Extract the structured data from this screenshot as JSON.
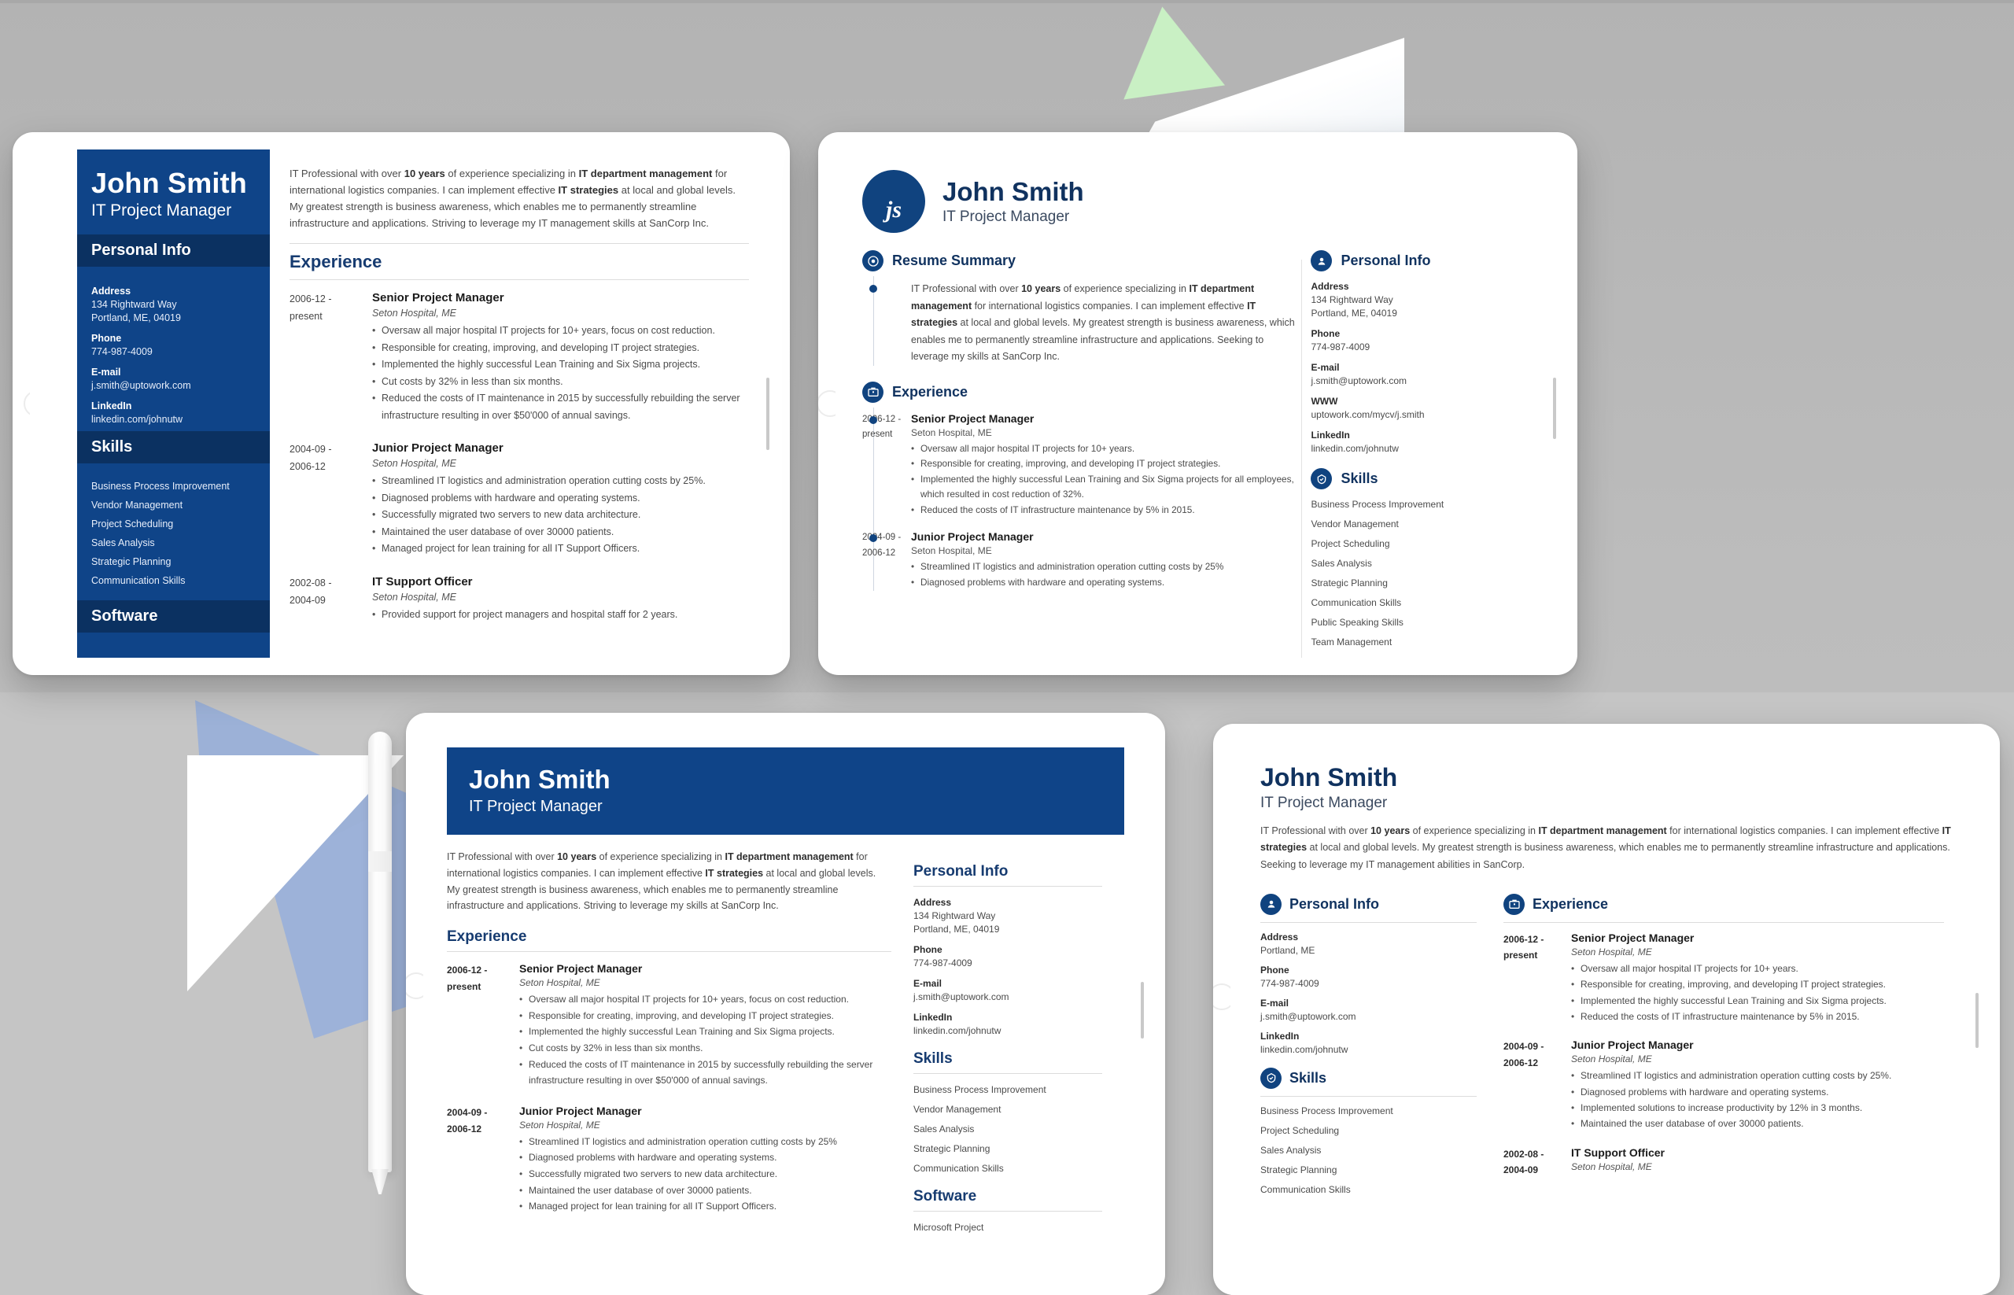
{
  "person": {
    "name": "John Smith",
    "title": "IT Project Manager",
    "initials": "js"
  },
  "colors": {
    "brand_navy": "#0f4488",
    "brand_dark_navy": "#0b3161",
    "heading_navy": "#163b70",
    "background_gray": "#b9b9b9",
    "accent_green": "#c9f0c4",
    "accent_blue": "#9ab0d8"
  },
  "summaries": {
    "long_sancorp_skills": {
      "p1": "IT Professional with over ",
      "b1": "10 years",
      "p2": " of experience specializing in ",
      "b2": "IT department management",
      "p3": " for international logistics companies. I can implement effective ",
      "b3": "IT strategies",
      "p4": " at local and global levels. My greatest strength is business awareness, which enables me to permanently streamline infrastructure and applications. Striving to leverage my IT management skills at SanCorp Inc."
    },
    "long_sancorp_skills_short": {
      "p4": " at local and global levels. My greatest strength is business awareness, which enables me to permanently streamline infrastructure and applications. Striving to leverage my skills at SanCorp Inc."
    },
    "seeking_skills": {
      "p4": " at local and global levels. My greatest strength is business awareness, which enables me to permanently streamline infrastructure and applications. Seeking to leverage my skills at SanCorp Inc."
    },
    "seeking_abilities": {
      "p4": " at local and global levels. My greatest strength is business awareness, which enables me to permanently streamline infrastructure and applications. Seeking to leverage my IT management abilities in SanCorp."
    }
  },
  "section_titles": {
    "personal_info": "Personal Info",
    "skills": "Skills",
    "software": "Software",
    "experience": "Experience",
    "resume_summary": "Resume Summary"
  },
  "contact_labels": {
    "address": "Address",
    "phone": "Phone",
    "email": "E-mail",
    "www": "WWW",
    "linkedin": "LinkedIn"
  },
  "contact": {
    "address_line1": "134 Rightward Way",
    "address_line2": "Portland, ME, 04019",
    "address_short": "Portland, ME",
    "phone": "774-987-4009",
    "email": "j.smith@uptowork.com",
    "www": "uptowork.com/mycv/j.smith",
    "linkedin": "linkedin.com/johnutw"
  },
  "skills_full": [
    "Business Process Improvement",
    "Vendor Management",
    "Project Scheduling",
    "Sales Analysis",
    "Strategic Planning",
    "Communication Skills"
  ],
  "skills_extended": [
    "Business Process Improvement",
    "Vendor Management",
    "Project Scheduling",
    "Sales Analysis",
    "Strategic Planning",
    "Communication Skills",
    "Public Speaking Skills",
    "Team Management"
  ],
  "skills_card3": [
    "Business Process Improvement",
    "Vendor Management",
    "Sales Analysis",
    "Strategic Planning",
    "Communication Skills"
  ],
  "skills_card4": [
    "Business Process Improvement",
    "Project Scheduling",
    "Sales Analysis",
    "Strategic Planning",
    "Communication Skills"
  ],
  "software_first_item": "Microsoft Project",
  "experience_full": [
    {
      "dates_from": "2006-12 -",
      "dates_to": "present",
      "title": "Senior Project Manager",
      "company": "Seton Hospital, ME",
      "bullets": [
        "Oversaw all major hospital IT projects for 10+ years, focus on cost reduction.",
        "Responsible for creating, improving, and developing IT project strategies.",
        "Implemented the highly successful Lean Training and Six Sigma projects.",
        "Cut costs by 32% in less than six months.",
        "Reduced the costs of IT maintenance in 2015 by successfully rebuilding the server infrastructure resulting in over $50'000 of annual savings."
      ]
    },
    {
      "dates_from": "2004-09 -",
      "dates_to": "2006-12",
      "title": "Junior Project Manager",
      "company": "Seton Hospital, ME",
      "bullets": [
        "Streamlined IT logistics and administration operation cutting costs by 25%.",
        "Diagnosed problems with hardware and operating systems.",
        "Successfully migrated two servers to new data architecture.",
        "Maintained the user database of over 30000 patients.",
        "Managed project for lean training for all IT Support Officers."
      ]
    },
    {
      "dates_from": "2002-08 -",
      "dates_to": "2004-09",
      "title": "IT Support Officer",
      "company": "Seton Hospital, ME",
      "bullets": [
        "Provided support for project managers and hospital staff for 2 years."
      ]
    }
  ],
  "experience_card3": [
    {
      "dates_from": "2006-12 -",
      "dates_to": "present",
      "title": "Senior Project Manager",
      "company": "Seton Hospital, ME",
      "bullets": [
        "Oversaw all major hospital IT projects for 10+ years, focus on cost reduction.",
        "Responsible for creating, improving, and developing IT project strategies.",
        "Implemented the highly successful Lean Training and Six Sigma projects.",
        "Cut costs by 32% in less than six months.",
        "Reduced the costs of IT maintenance in 2015 by successfully rebuilding the server infrastructure resulting in over $50'000 of annual savings."
      ]
    },
    {
      "dates_from": "2004-09 -",
      "dates_to": "2006-12",
      "title": "Junior Project Manager",
      "company": "Seton Hospital, ME",
      "bullets": [
        "Streamlined IT logistics and administration operation cutting costs by 25%",
        "Diagnosed problems with hardware and operating systems.",
        "Successfully migrated two servers to new data architecture.",
        "Maintained the user database of over 30000 patients.",
        "Managed project for lean training for all IT Support Officers."
      ]
    }
  ],
  "experience_timeline": [
    {
      "dates_from": "2006-12 -",
      "dates_to": "present",
      "title": "Senior Project Manager",
      "company": "Seton Hospital, ME",
      "bullets": [
        "Oversaw all major hospital IT projects for 10+ years.",
        "Responsible for creating, improving, and developing IT project strategies.",
        "Implemented the highly successful Lean Training and Six Sigma projects for all employees, which resulted in cost reduction of 32%.",
        "Reduced the costs of IT infrastructure maintenance by 5% in 2015."
      ]
    },
    {
      "dates_from": "2004-09 -",
      "dates_to": "2006-12",
      "title": "Junior Project Manager",
      "company": "Seton Hospital, ME",
      "bullets": [
        "Streamlined IT logistics and administration operation cutting costs by 25%",
        "Diagnosed problems with hardware and operating systems."
      ]
    }
  ],
  "experience_card4": [
    {
      "dates_from": "2006-12 -",
      "dates_to": "present",
      "title": "Senior Project Manager",
      "company": "Seton Hospital, ME",
      "bullets": [
        "Oversaw all major hospital IT projects for 10+ years.",
        "Responsible for creating, improving, and developing IT project strategies.",
        "Implemented the highly successful Lean Training and Six Sigma projects.",
        "Reduced the costs of IT infrastructure maintenance by 5% in 2015."
      ]
    },
    {
      "dates_from": "2004-09 -",
      "dates_to": "2006-12",
      "title": "Junior Project Manager",
      "company": "Seton Hospital, ME",
      "bullets": [
        "Streamlined IT logistics and administration operation cutting costs by 25%.",
        "Diagnosed problems with hardware and operating systems.",
        "Implemented solutions to increase productivity by 12% in 3 months.",
        "Maintained the user database of over 30000 patients."
      ]
    },
    {
      "dates_from": "2002-08 -",
      "dates_to": "2004-09",
      "title": "IT Support Officer",
      "company": "Seton Hospital, ME",
      "bullets": []
    }
  ]
}
